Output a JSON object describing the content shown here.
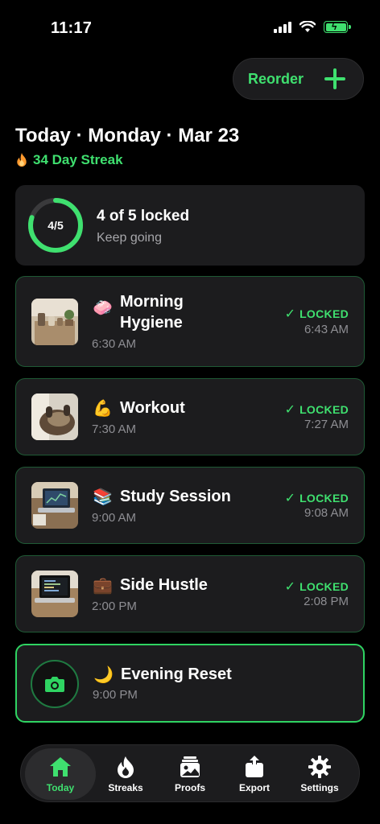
{
  "status_bar": {
    "time": "11:17"
  },
  "header": {
    "reorder_label": "Reorder",
    "title": "Today · Monday · Mar 23",
    "streak": "34 Day Streak"
  },
  "progress": {
    "ring_label": "4/5",
    "completed": 4,
    "total": 5,
    "title": "4 of 5 locked",
    "subtitle": "Keep going"
  },
  "tasks": [
    {
      "emoji": "🧼",
      "name": "Morning Hygiene",
      "time": "6:30 AM",
      "status": "LOCKED",
      "done_time": "6:43 AM"
    },
    {
      "emoji": "💪",
      "name": "Workout",
      "time": "7:30 AM",
      "status": "LOCKED",
      "done_time": "7:27 AM"
    },
    {
      "emoji": "📚",
      "name": "Study Session",
      "time": "9:00 AM",
      "status": "LOCKED",
      "done_time": "9:08 AM"
    },
    {
      "emoji": "💼",
      "name": "Side Hustle",
      "time": "2:00 PM",
      "status": "LOCKED",
      "done_time": "2:08 PM"
    },
    {
      "emoji": "🌙",
      "name": "Evening Reset",
      "time": "9:00 PM"
    }
  ],
  "tabs": [
    {
      "label": "Today",
      "icon": "home-icon"
    },
    {
      "label": "Streaks",
      "icon": "flame-icon"
    },
    {
      "label": "Proofs",
      "icon": "photos-icon"
    },
    {
      "label": "Export",
      "icon": "share-icon"
    },
    {
      "label": "Settings",
      "icon": "gear-icon"
    }
  ],
  "colors": {
    "accent": "#3fe06f",
    "background": "#000000",
    "card": "#1c1c1e",
    "secondary_text": "#8e8e93"
  }
}
